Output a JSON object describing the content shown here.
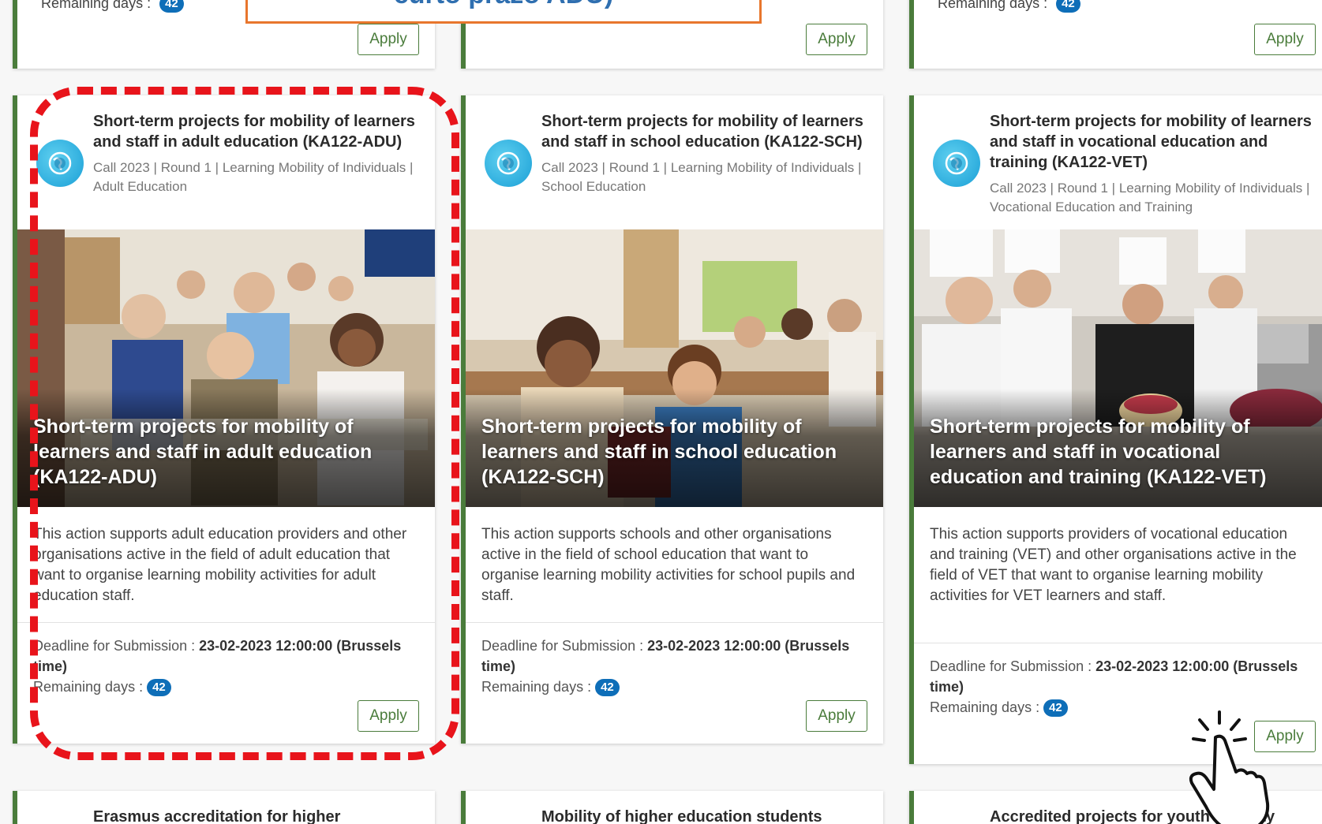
{
  "callout": {
    "text": "curto prazo ADU)"
  },
  "top_row": [
    {
      "remaining_label": "Remaining days :",
      "remaining_value": "42",
      "apply_label": "Apply"
    },
    {
      "remaining_label": "",
      "remaining_value": "",
      "apply_label": "Apply"
    },
    {
      "remaining_label": "Remaining days :",
      "remaining_value": "42",
      "apply_label": "Apply"
    }
  ],
  "cards": [
    {
      "title": "Short-term projects for mobility of learners and staff in adult education (KA122-ADU)",
      "meta": "Call 2023 | Round 1 | Learning Mobility of Individuals | Adult Education",
      "hero_title": "Short-term projects for mobility of learners and staff in adult education (KA122-ADU)",
      "description": "This action supports adult education providers and other organisations active in the field of adult education that want to organise learning mobility activities for adult education staff.",
      "deadline_label": "Deadline for Submission :",
      "deadline_value": "23-02-2023 12:00:00 (Brussels time)",
      "remaining_label": "Remaining days :",
      "remaining_value": "42",
      "apply_label": "Apply",
      "photo": "adult-classroom"
    },
    {
      "title": "Short-term projects for mobility of learners and staff in school education (KA122-SCH)",
      "meta": "Call 2023 | Round 1 | Learning Mobility of Individuals | School Education",
      "hero_title": "Short-term projects for mobility of learners and staff in school education (KA122-SCH)",
      "description": "This action supports schools and other organisations active in the field of school education that want to organise learning mobility activities for school pupils and staff.",
      "deadline_label": "Deadline for Submission :",
      "deadline_value": "23-02-2023 12:00:00 (Brussels time)",
      "remaining_label": "Remaining days :",
      "remaining_value": "42",
      "apply_label": "Apply",
      "photo": "school-classroom"
    },
    {
      "title": "Short-term projects for mobility of learners and staff in vocational education and training (KA122-VET)",
      "meta": "Call 2023 | Round 1 | Learning Mobility of Individuals | Vocational Education and Training",
      "hero_title": "Short-term projects for mobility of learners and staff in vocational education and training (KA122-VET)",
      "description": "This action supports providers of vocational education and training (VET) and other organisations active in the field of VET that want to organise learning mobility activities for VET learners and staff.",
      "deadline_label": "Deadline for Submission :",
      "deadline_value": "23-02-2023 12:00:00 (Brussels time)",
      "remaining_label": "Remaining days :",
      "remaining_value": "42",
      "apply_label": "Apply",
      "photo": "chefs-kitchen"
    }
  ],
  "bottom_row": [
    {
      "title": "Erasmus accreditation for higher"
    },
    {
      "title": "Mobility of higher education students"
    },
    {
      "title": "Accredited projects for youth mobility"
    }
  ],
  "colors": {
    "accent_green": "#4a7c3b",
    "badge_blue": "#0e6eb8",
    "highlight_red": "#e8141b",
    "callout_orange": "#e8762d",
    "callout_text_blue": "#2f6fb0"
  }
}
